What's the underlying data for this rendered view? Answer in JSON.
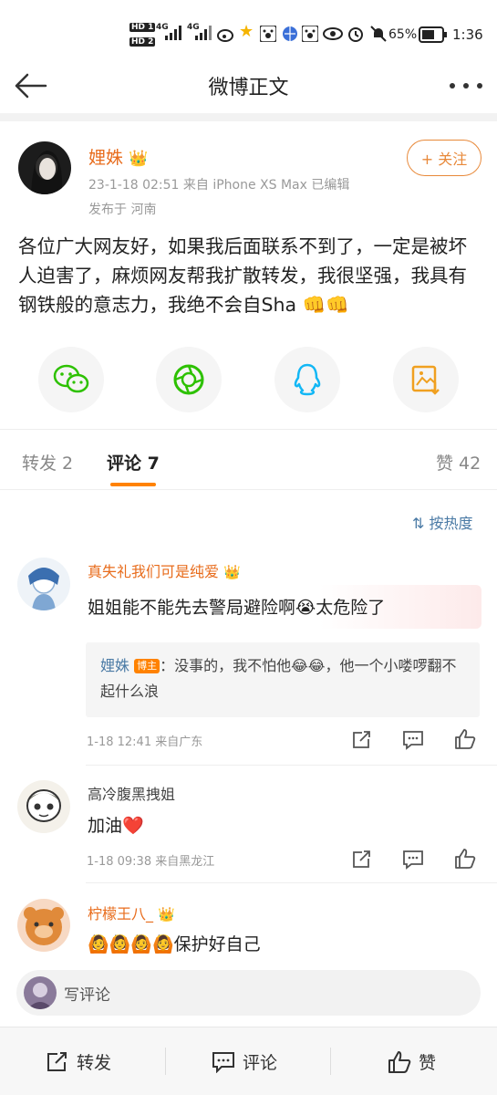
{
  "status_bar": {
    "hd1": "HD 1",
    "hd2": "HD 2",
    "net1": "4G",
    "net2": "4G",
    "battery": "65%",
    "time": "1:36"
  },
  "nav": {
    "title": "微博正文",
    "back_icon": "arrow-left-icon",
    "more_icon": "more-dots-icon"
  },
  "post": {
    "author": "娌姝",
    "meta": "23-1-18 02:51  来自 iPhone XS Max  已编辑",
    "location": "发布于 河南",
    "follow_label": "+ 关注",
    "body": "各位广大网友好，如果我后面联系不到了，一定是被坏人迫害了，麻烦网友帮我扩散转发，我很坚强，我具有钢铁般的意志力，我绝不会自Sha 👊👊"
  },
  "share": [
    "wechat-icon",
    "moments-icon",
    "qq-icon",
    "save-image-icon"
  ],
  "tabs": {
    "repost": "转发 2",
    "comments": "评论 7",
    "likes": "赞 42"
  },
  "sort_label": "按热度",
  "comments": [
    {
      "name": "真失礼我们可是纯爱",
      "text": "姐姐能不能先去警局避险啊😭太危险了",
      "reply_name": "娌姝",
      "reply_badge": "博主",
      "reply_text": "：没事的，我不怕他😂😂，他一个小喽啰翻不起什么浪",
      "meta": "1-18 12:41  来自广东"
    },
    {
      "name": "高冷腹黑拽姐",
      "text": "加油❤️",
      "meta": "1-18 09:38  来自黑龙江"
    },
    {
      "name": "柠檬王八_",
      "text": "🙆🙆🙆🙆保护好自己"
    }
  ],
  "compose_placeholder": "写评论",
  "bottom": {
    "repost": "转发",
    "comment": "评论",
    "like": "赞"
  },
  "colors": {
    "accent": "#ff8200",
    "name_orange": "#e86c1c",
    "link_blue": "#4a7aa5"
  }
}
